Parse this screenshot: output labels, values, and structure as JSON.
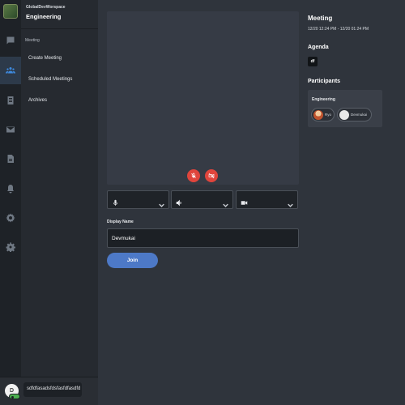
{
  "workspace": {
    "name": "GlobalDevWorspace",
    "team": "Engineering"
  },
  "sidebar": {
    "section_label": "Meeting",
    "items": [
      {
        "label": "Create Meeting"
      },
      {
        "label": "Scheduled Meetings"
      },
      {
        "label": "Archives"
      }
    ]
  },
  "rail_icons": [
    "chat-icon",
    "people-icon",
    "clipboard-icon",
    "mail-icon",
    "document-icon",
    "bell-icon",
    "settings-icon",
    "gear-icon"
  ],
  "user": {
    "avatar_initial": "D",
    "name": "sdfdfasadsfdsfasfdfasdfd",
    "status_color": "#4caf50"
  },
  "call_controls": {
    "mute_icon": "mic-off-icon",
    "video_icon": "video-off-icon",
    "button_color": "#e0453c"
  },
  "devices": [
    {
      "icon": "microphone-icon"
    },
    {
      "icon": "speaker-icon"
    },
    {
      "icon": "camera-icon"
    }
  ],
  "form": {
    "display_name_label": "Display Name",
    "display_name_value": "Devmukai",
    "join_label": "Join",
    "join_color": "#4d79c7"
  },
  "meeting_info": {
    "title": "Meeting",
    "time": "12/20 12:24 PM - 12/20 01:24 PM",
    "agenda_label": "Agenda",
    "agenda_value": "df",
    "participants_label": "Participants",
    "participants_team": "Engineering",
    "participants": [
      {
        "name": "Ryo"
      },
      {
        "name": "Devmukai"
      }
    ]
  },
  "colors": {
    "accent": "#3e8be0",
    "background": "#2f343c"
  }
}
